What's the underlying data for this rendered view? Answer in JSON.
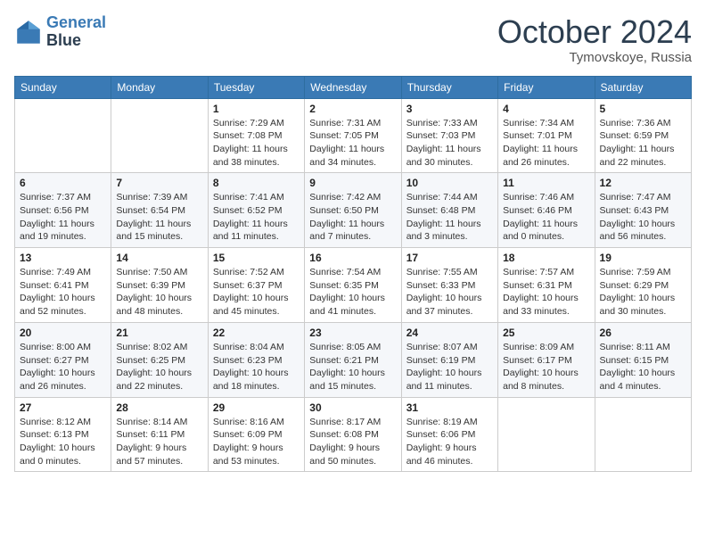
{
  "header": {
    "logo_line1": "General",
    "logo_line2": "Blue",
    "month": "October 2024",
    "location": "Tymovskoye, Russia"
  },
  "weekdays": [
    "Sunday",
    "Monday",
    "Tuesday",
    "Wednesday",
    "Thursday",
    "Friday",
    "Saturday"
  ],
  "weeks": [
    [
      {
        "day": "",
        "info": ""
      },
      {
        "day": "",
        "info": ""
      },
      {
        "day": "1",
        "info": "Sunrise: 7:29 AM\nSunset: 7:08 PM\nDaylight: 11 hours and 38 minutes."
      },
      {
        "day": "2",
        "info": "Sunrise: 7:31 AM\nSunset: 7:05 PM\nDaylight: 11 hours and 34 minutes."
      },
      {
        "day": "3",
        "info": "Sunrise: 7:33 AM\nSunset: 7:03 PM\nDaylight: 11 hours and 30 minutes."
      },
      {
        "day": "4",
        "info": "Sunrise: 7:34 AM\nSunset: 7:01 PM\nDaylight: 11 hours and 26 minutes."
      },
      {
        "day": "5",
        "info": "Sunrise: 7:36 AM\nSunset: 6:59 PM\nDaylight: 11 hours and 22 minutes."
      }
    ],
    [
      {
        "day": "6",
        "info": "Sunrise: 7:37 AM\nSunset: 6:56 PM\nDaylight: 11 hours and 19 minutes."
      },
      {
        "day": "7",
        "info": "Sunrise: 7:39 AM\nSunset: 6:54 PM\nDaylight: 11 hours and 15 minutes."
      },
      {
        "day": "8",
        "info": "Sunrise: 7:41 AM\nSunset: 6:52 PM\nDaylight: 11 hours and 11 minutes."
      },
      {
        "day": "9",
        "info": "Sunrise: 7:42 AM\nSunset: 6:50 PM\nDaylight: 11 hours and 7 minutes."
      },
      {
        "day": "10",
        "info": "Sunrise: 7:44 AM\nSunset: 6:48 PM\nDaylight: 11 hours and 3 minutes."
      },
      {
        "day": "11",
        "info": "Sunrise: 7:46 AM\nSunset: 6:46 PM\nDaylight: 11 hours and 0 minutes."
      },
      {
        "day": "12",
        "info": "Sunrise: 7:47 AM\nSunset: 6:43 PM\nDaylight: 10 hours and 56 minutes."
      }
    ],
    [
      {
        "day": "13",
        "info": "Sunrise: 7:49 AM\nSunset: 6:41 PM\nDaylight: 10 hours and 52 minutes."
      },
      {
        "day": "14",
        "info": "Sunrise: 7:50 AM\nSunset: 6:39 PM\nDaylight: 10 hours and 48 minutes."
      },
      {
        "day": "15",
        "info": "Sunrise: 7:52 AM\nSunset: 6:37 PM\nDaylight: 10 hours and 45 minutes."
      },
      {
        "day": "16",
        "info": "Sunrise: 7:54 AM\nSunset: 6:35 PM\nDaylight: 10 hours and 41 minutes."
      },
      {
        "day": "17",
        "info": "Sunrise: 7:55 AM\nSunset: 6:33 PM\nDaylight: 10 hours and 37 minutes."
      },
      {
        "day": "18",
        "info": "Sunrise: 7:57 AM\nSunset: 6:31 PM\nDaylight: 10 hours and 33 minutes."
      },
      {
        "day": "19",
        "info": "Sunrise: 7:59 AM\nSunset: 6:29 PM\nDaylight: 10 hours and 30 minutes."
      }
    ],
    [
      {
        "day": "20",
        "info": "Sunrise: 8:00 AM\nSunset: 6:27 PM\nDaylight: 10 hours and 26 minutes."
      },
      {
        "day": "21",
        "info": "Sunrise: 8:02 AM\nSunset: 6:25 PM\nDaylight: 10 hours and 22 minutes."
      },
      {
        "day": "22",
        "info": "Sunrise: 8:04 AM\nSunset: 6:23 PM\nDaylight: 10 hours and 18 minutes."
      },
      {
        "day": "23",
        "info": "Sunrise: 8:05 AM\nSunset: 6:21 PM\nDaylight: 10 hours and 15 minutes."
      },
      {
        "day": "24",
        "info": "Sunrise: 8:07 AM\nSunset: 6:19 PM\nDaylight: 10 hours and 11 minutes."
      },
      {
        "day": "25",
        "info": "Sunrise: 8:09 AM\nSunset: 6:17 PM\nDaylight: 10 hours and 8 minutes."
      },
      {
        "day": "26",
        "info": "Sunrise: 8:11 AM\nSunset: 6:15 PM\nDaylight: 10 hours and 4 minutes."
      }
    ],
    [
      {
        "day": "27",
        "info": "Sunrise: 8:12 AM\nSunset: 6:13 PM\nDaylight: 10 hours and 0 minutes."
      },
      {
        "day": "28",
        "info": "Sunrise: 8:14 AM\nSunset: 6:11 PM\nDaylight: 9 hours and 57 minutes."
      },
      {
        "day": "29",
        "info": "Sunrise: 8:16 AM\nSunset: 6:09 PM\nDaylight: 9 hours and 53 minutes."
      },
      {
        "day": "30",
        "info": "Sunrise: 8:17 AM\nSunset: 6:08 PM\nDaylight: 9 hours and 50 minutes."
      },
      {
        "day": "31",
        "info": "Sunrise: 8:19 AM\nSunset: 6:06 PM\nDaylight: 9 hours and 46 minutes."
      },
      {
        "day": "",
        "info": ""
      },
      {
        "day": "",
        "info": ""
      }
    ]
  ]
}
